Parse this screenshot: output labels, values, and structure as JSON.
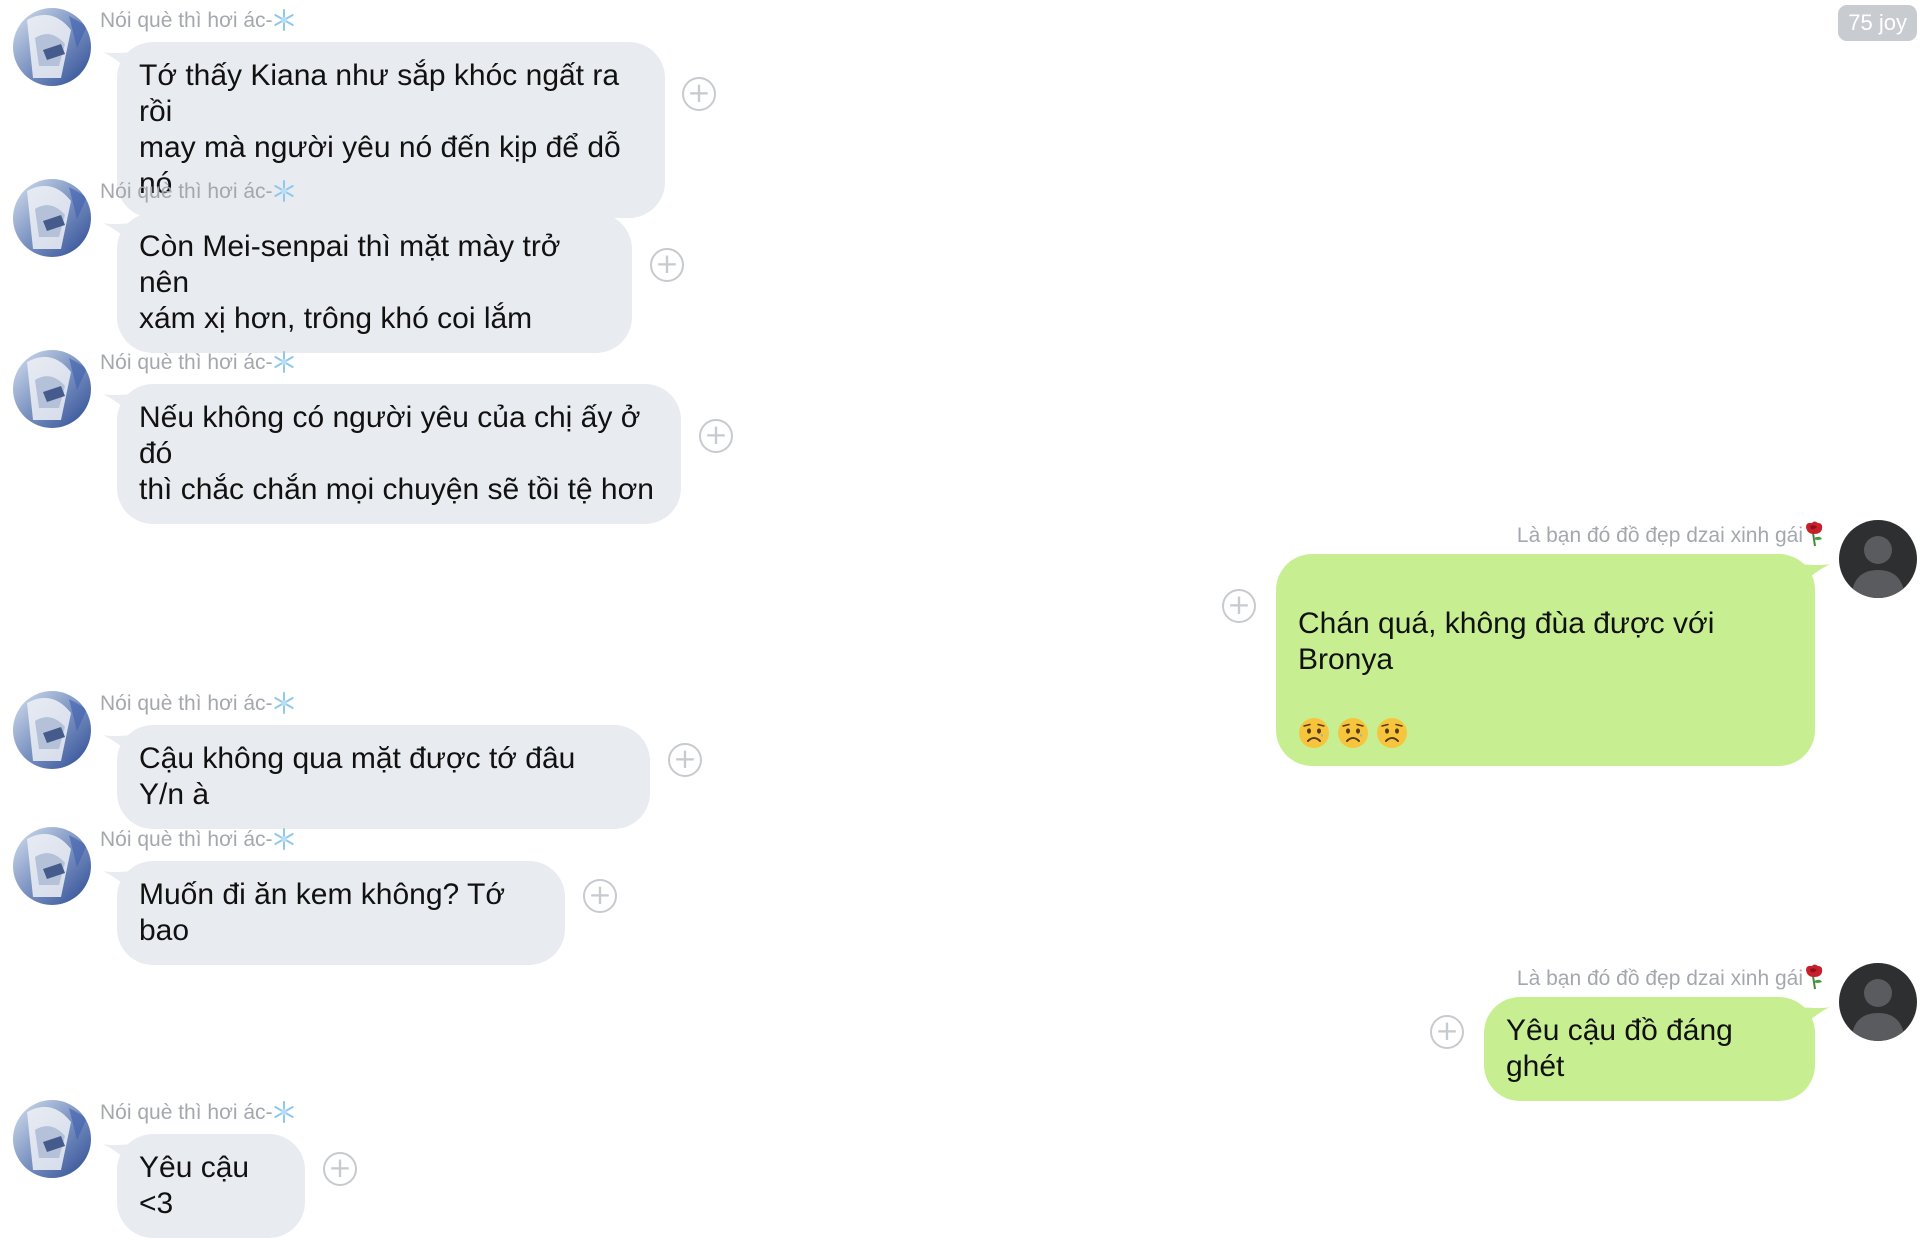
{
  "joy_badge": "75 joy",
  "incoming_name": "Nói què thì hơi ác-",
  "outgoing_name": "Là bạn đó đồ đẹp dzai xinh gái",
  "messages": [
    {
      "side": "in",
      "text": "Tớ thấy Kiana như sắp khóc ngất ra rồi\nmay mà người yêu nó đến kịp để dỗ nó"
    },
    {
      "side": "in",
      "text": "Còn Mei-senpai thì mặt mày trở nên\nxám xị hơn, trông khó coi lắm"
    },
    {
      "side": "in",
      "text": "Nếu không có người yêu của chị ấy ở đó\nthì chắc chắn mọi chuyện sẽ tồi tệ hơn"
    },
    {
      "side": "out",
      "text": "Chán quá, không đùa được với Bronya",
      "emoji": [
        "sad-face",
        "sad-face",
        "sad-face"
      ]
    },
    {
      "side": "in",
      "text": "Cậu không qua mặt được tớ đâu Y/n à"
    },
    {
      "side": "in",
      "text": "Muốn đi ăn kem không? Tớ bao"
    },
    {
      "side": "out",
      "text": "Yêu cậu đồ đáng ghét"
    },
    {
      "side": "in",
      "text": "Yêu cậu <3"
    }
  ],
  "colors": {
    "incoming_bubble": "#e8ebef",
    "outgoing_bubble": "#c7ef92",
    "name_text": "#a4a8ae"
  },
  "icons": {
    "add": "plus-circle-icon",
    "incoming_name_suffix": "snowflake-icon",
    "outgoing_name_suffix": "rose-icon"
  }
}
